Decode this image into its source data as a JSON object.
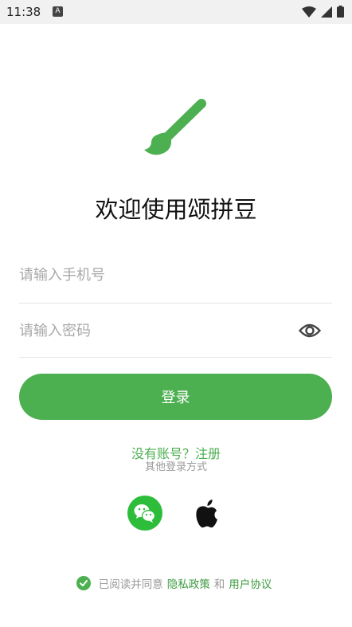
{
  "status_bar": {
    "time": "11:38",
    "notification_icon": "A"
  },
  "app": {
    "title": "欢迎使用颂拼豆"
  },
  "form": {
    "phone_placeholder": "请输入手机号",
    "password_placeholder": "请输入密码",
    "login_label": "登录"
  },
  "links": {
    "register": "没有账号？注册",
    "other_login": "其他登录方式"
  },
  "agreement": {
    "prefix": "已阅读并同意",
    "privacy": "隐私政策",
    "and": "和",
    "terms": "用户协议"
  },
  "colors": {
    "accent": "#4caf50",
    "wechat": "#2dbd3a"
  }
}
